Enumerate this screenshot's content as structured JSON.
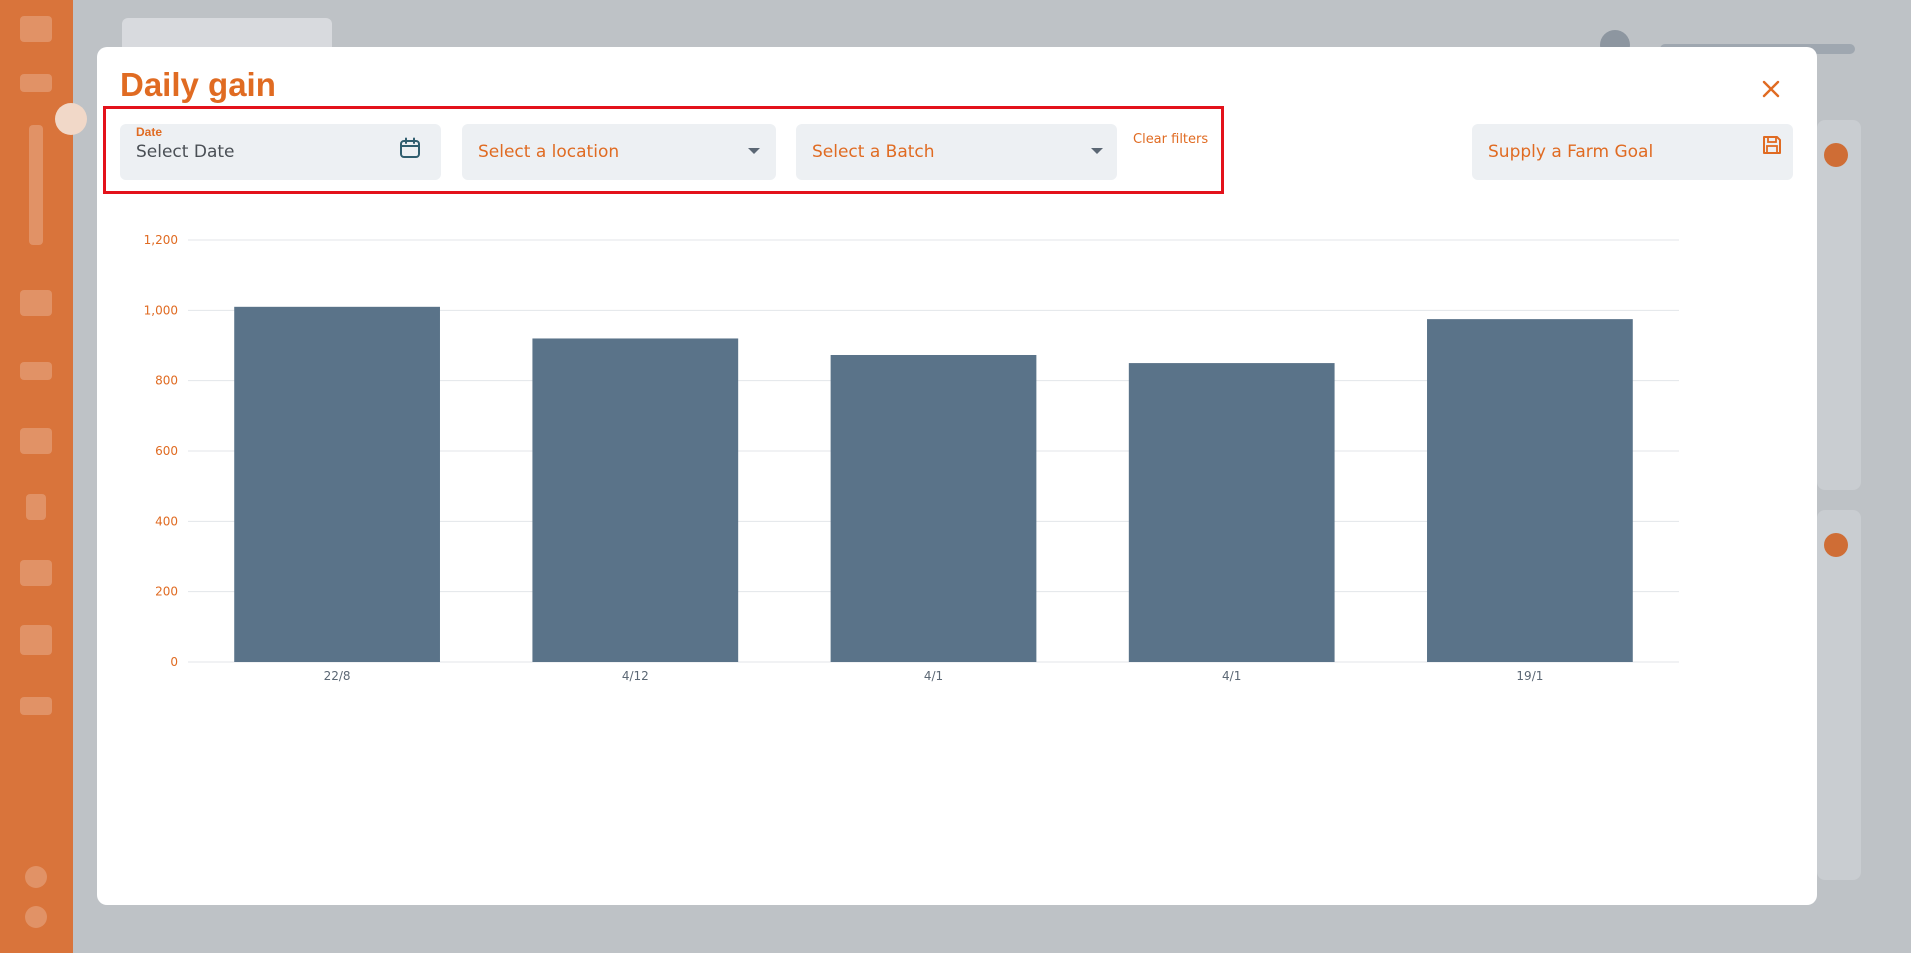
{
  "modal": {
    "title": "Daily gain",
    "close_icon": "close-icon"
  },
  "filters": {
    "date": {
      "label": "Date",
      "placeholder": "Select Date",
      "icon": "calendar-icon"
    },
    "location": {
      "placeholder": "Select a location",
      "icon": "caret-down-icon"
    },
    "batch": {
      "placeholder": "Select a Batch",
      "icon": "caret-down-icon"
    },
    "clear_label": "Clear filters",
    "farm_goal": {
      "placeholder": "Supply a Farm Goal",
      "icon": "save-icon"
    }
  },
  "colors": {
    "accent": "#e06b22",
    "bar": "#5a7389",
    "highlight_box": "#e3121b",
    "field_bg": "#edf0f3"
  },
  "chart_data": {
    "type": "bar",
    "categories": [
      "22/8",
      "4/12",
      "4/1",
      "4/1",
      "19/1"
    ],
    "values": [
      1010,
      920,
      873,
      850,
      975
    ],
    "y_ticks": [
      "0",
      "200",
      "400",
      "600",
      "800",
      "1,000",
      "1,200"
    ],
    "ylim": [
      0,
      1200
    ],
    "grid": true
  }
}
